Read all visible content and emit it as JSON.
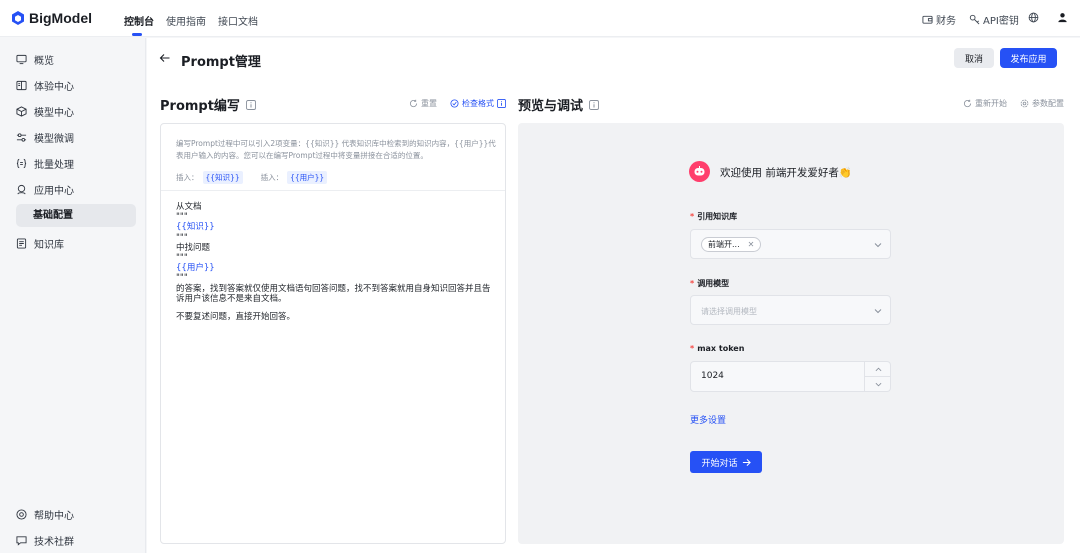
{
  "brand": {
    "name": "BigModel"
  },
  "topnav": {
    "tabs": [
      {
        "label": "控制台"
      },
      {
        "label": "使用指南"
      },
      {
        "label": "接口文档"
      }
    ],
    "right": {
      "finance": "财务",
      "api_key": "API密钥"
    }
  },
  "sidebar": {
    "items": [
      {
        "label": "概览",
        "icon": "monitor-icon"
      },
      {
        "label": "体验中心",
        "icon": "book-icon"
      },
      {
        "label": "模型中心",
        "icon": "cube-icon"
      },
      {
        "label": "模型微调",
        "icon": "adjust-icon"
      },
      {
        "label": "批量处理",
        "icon": "brackets-icon"
      },
      {
        "label": "应用中心",
        "icon": "robot-icon"
      }
    ],
    "sub_item": "基础配置",
    "kb_item": "知识库",
    "bottom": [
      {
        "label": "帮助中心",
        "icon": "help-icon"
      },
      {
        "label": "技术社群",
        "icon": "chat-icon"
      }
    ]
  },
  "header": {
    "title": "Prompt管理",
    "cancel": "取消",
    "publish": "发布应用"
  },
  "editor": {
    "title": "Prompt编写",
    "reset": "重置",
    "check_format": "检查格式",
    "hint": "编写Prompt过程中可以引入2项变量：{{知识}} 代表知识库中检索到的知识内容，{{用户}}代表用户输入的内容。您可以在编写Prompt过程中将变量拼接在合适的位置。",
    "insert_label_1": "插入：",
    "insert_chip_1": "{{知识}}",
    "insert_label_2": "插入：",
    "insert_chip_2": "{{用户}}",
    "lines": {
      "l1": "从文档",
      "l2": "\"\"\"",
      "l3": "{{知识}}",
      "l4": "\"\"\"",
      "l5": "中找问题",
      "l6": "\"\"\"",
      "l7": "{{用户}}",
      "l8": "\"\"\"",
      "l9": "的答案，找到答案就仅使用文档语句回答问题，找不到答案就用自身知识回答并且告诉用户该信息不是来自文档。",
      "l10": "不要复述问题，直接开始回答。"
    }
  },
  "preview": {
    "title": "预览与调试",
    "restart": "重新开始",
    "params": "参数配置",
    "welcome": "欢迎使用 前端开发爱好者👏",
    "kb_label": "引用知识库",
    "kb_tag": "前端开...",
    "model_label": "调用模型",
    "model_placeholder": "请选择调用模型",
    "max_token_label": "max token",
    "max_token_value": "1024",
    "more_settings": "更多设置",
    "start": "开始对话"
  },
  "colors": {
    "accent": "#2651f5",
    "avatar": "#ff3e6c",
    "required": "#f54a45"
  }
}
